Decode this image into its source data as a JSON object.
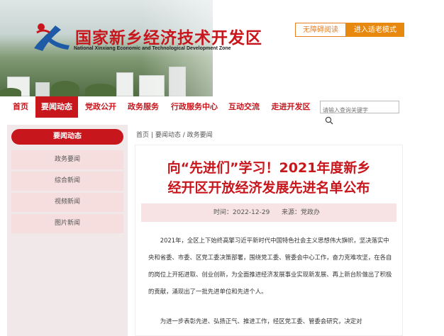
{
  "header": {
    "title": "国家新乡经济技术开发区",
    "subtitle": "National Xinxiang Economic and Technological Development Zone",
    "barrier_free_label": "无障碍阅读",
    "elderly_mode_label": "进入适老模式"
  },
  "nav": {
    "items": [
      {
        "label": "首页"
      },
      {
        "label": "要闻动态"
      },
      {
        "label": "党政公开"
      },
      {
        "label": "政务服务"
      },
      {
        "label": "行政服务中心"
      },
      {
        "label": "互动交流"
      },
      {
        "label": "走进开发区"
      }
    ],
    "search_placeholder": "请输入查询关键字"
  },
  "sidebar": {
    "heading": "要闻动态",
    "items": [
      {
        "label": "政务要闻"
      },
      {
        "label": "综合新闻"
      },
      {
        "label": "视频新闻"
      },
      {
        "label": "图片新闻"
      }
    ]
  },
  "breadcrumb": {
    "home": "首页",
    "sep": "|",
    "section": "要闻动态",
    "sep2": "/",
    "page": "政务要闻"
  },
  "article": {
    "title_line1": "向“先进们”学习！2021年度新乡",
    "title_line2": "经开区开放经济发展先进名单公布",
    "time": "时间：2022-12-29",
    "source": "来源：党政办",
    "paragraphs": [
      "2021年，全区上下始终高擎习近平新时代中国特色社会主义思想伟大旗帜，坚决落实中央和省委、市委、区党工委决策部署，围绕党工委、管委会中心工作，奋力克难攻坚，在各自的岗位上开拓进取、创业创新，为全面推进经济发展事业实现新发展、再上新台阶做出了积极的贡献，涌现出了一批先进单位和先进个人。",
      "为进一步表彰先进、弘扬正气、推进工作，经区党工委、管委会研究，决定对"
    ]
  },
  "colors": {
    "brand_red": "#c8161d",
    "accent_orange": "#e8890f",
    "sidebar_bg": "#f1e9e9",
    "sidebar_item_bg": "#f7dede",
    "meta_bg": "#f7e3e3"
  },
  "icons": {
    "logo": "xinxiang-logo-icon",
    "search": "search-icon"
  }
}
